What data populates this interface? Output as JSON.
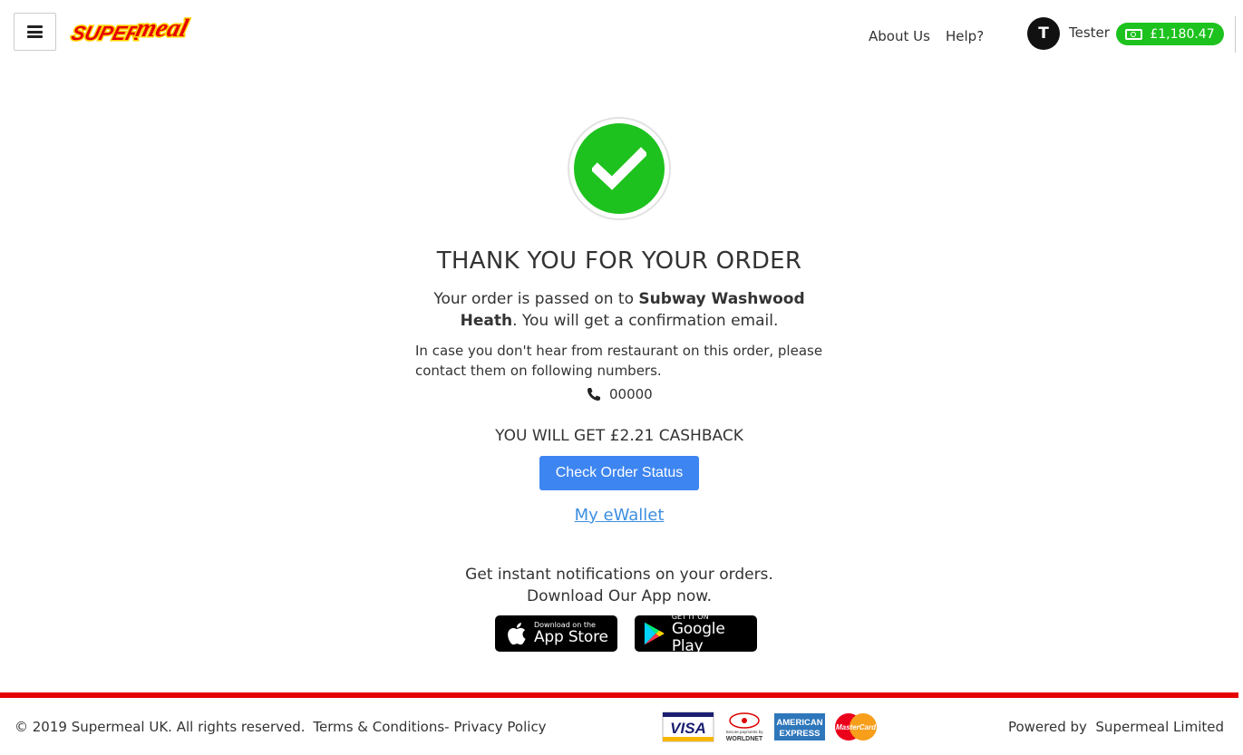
{
  "header": {
    "logo_text": "SUPERmeal",
    "nav": {
      "about": "About Us",
      "help": "Help?"
    },
    "user": {
      "initial": "T",
      "name": "Tester",
      "balance": "£1,180.47"
    }
  },
  "order": {
    "title": "THANK YOU FOR YOUR ORDER",
    "msg_prefix": "Your order is passed on to ",
    "restaurant": "Subway Washwood Heath",
    "msg_suffix": ". You will get a confirmation email.",
    "note": "In case you don't hear from restaurant on this order, please contact them on following numbers.",
    "phone": "00000",
    "cashback": "YOU WILL GET £2.21 CASHBACK",
    "status_button": "Check Order Status",
    "wallet_link": "My eWallet",
    "notify_line1": "Get instant notifications on your orders.",
    "notify_line2": "Download Our App now."
  },
  "apps": {
    "appstore": {
      "small": "Download on the",
      "big": "App Store"
    },
    "gplay": {
      "small": "GET IT ON",
      "big": "Google Play"
    }
  },
  "footer": {
    "copyright": "© 2019 Supermeal UK. All rights reserved.",
    "links": "Terms & Conditions- Privacy Policy",
    "powered": "Powered by  Supermeal Limited",
    "cards": {
      "visa": "VISA",
      "worldnet": "WORLDNET",
      "worldnet_small": "Secure payments by",
      "amex_1": "AMERICAN",
      "amex_2": "EXPRESS",
      "mastercard": "MasterCard"
    }
  },
  "colors": {
    "green": "#1ec21e",
    "primary_button": "#3d85f0",
    "link": "#3d8fe0",
    "footer_line": "#e60000"
  }
}
